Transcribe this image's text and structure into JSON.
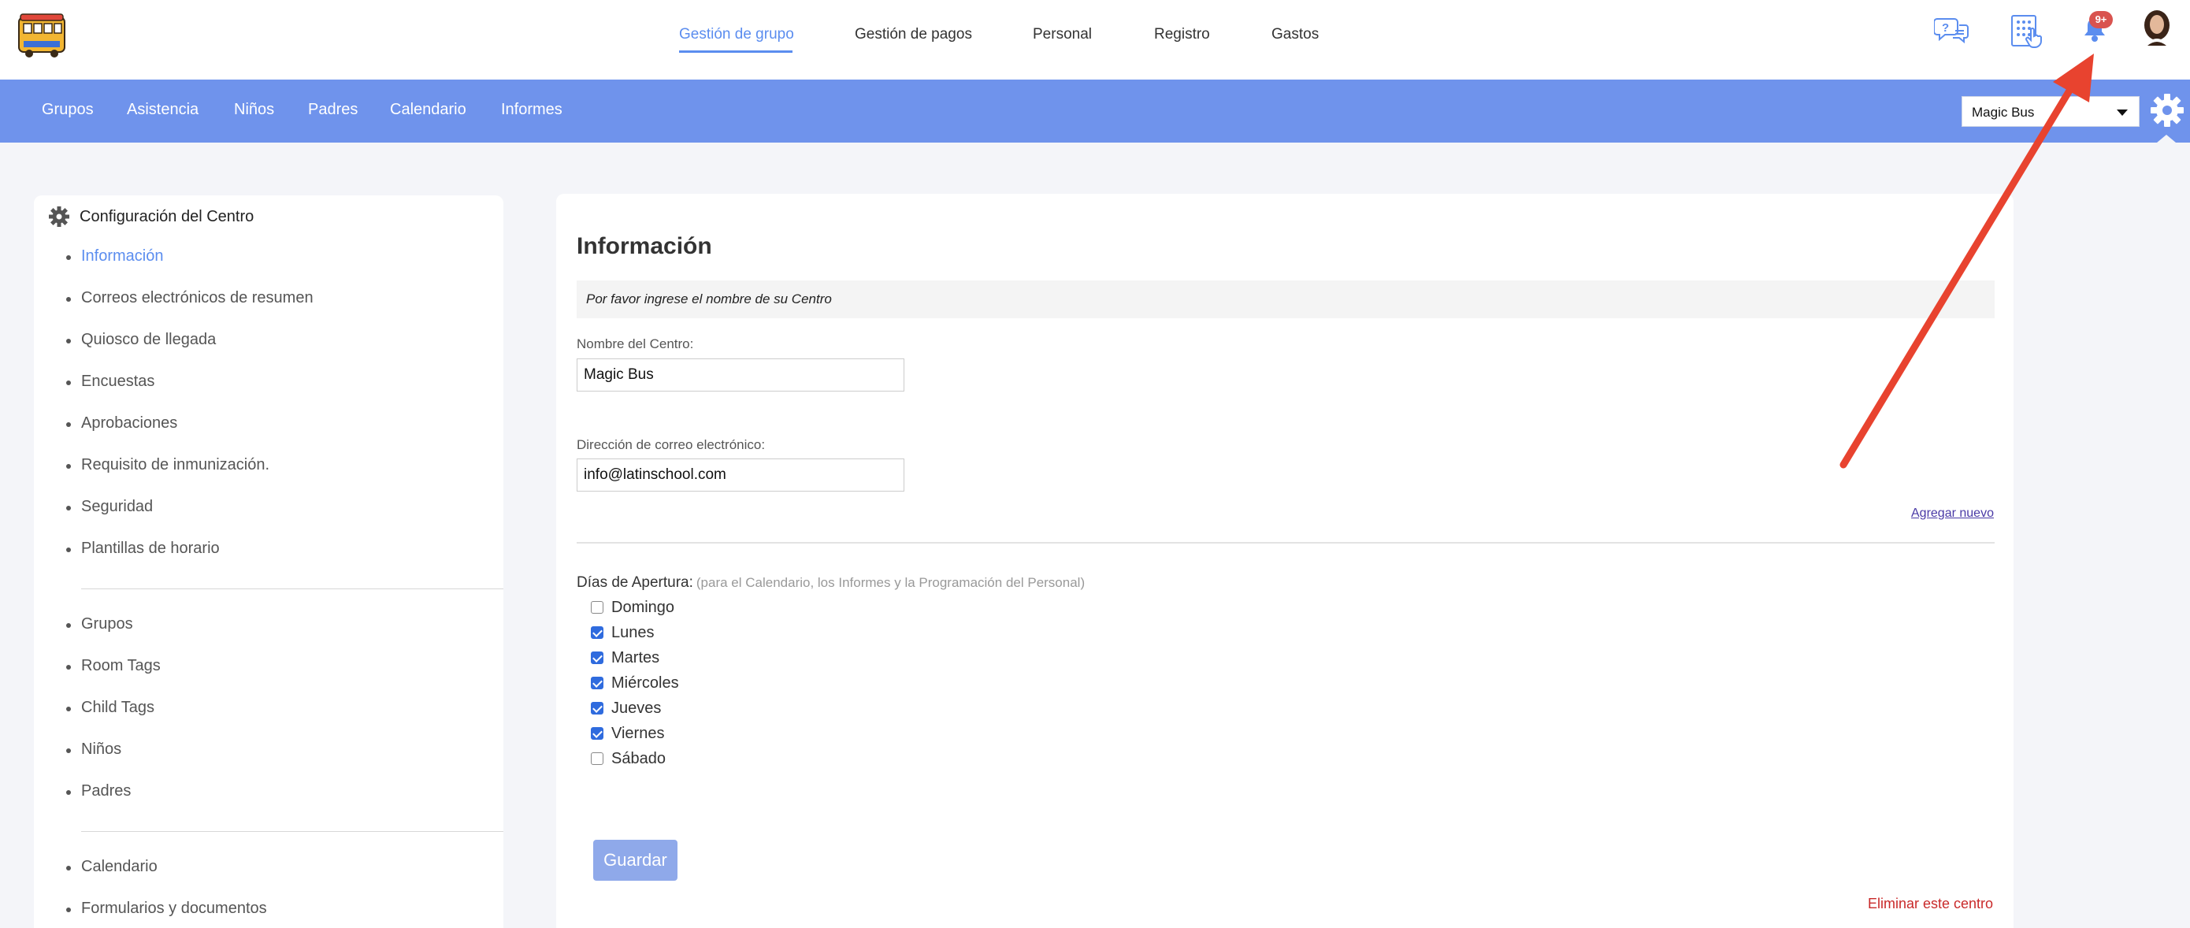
{
  "header": {
    "nav": [
      {
        "label": "Gestión de grupo",
        "active": true
      },
      {
        "label": "Gestión de pagos",
        "active": false
      },
      {
        "label": "Personal",
        "active": false
      },
      {
        "label": "Registro",
        "active": false
      },
      {
        "label": "Gastos",
        "active": false
      }
    ],
    "notifications_badge": "9+",
    "icons": [
      "help-chat-icon",
      "kiosk-keypad-icon",
      "bell-icon",
      "user-avatar"
    ]
  },
  "subnav": {
    "items": [
      "Grupos",
      "Asistencia",
      "Niños",
      "Padres",
      "Calendario",
      "Informes"
    ],
    "center_selected": "Magic Bus"
  },
  "sidebar": {
    "title": "Configuración del Centro",
    "items": [
      "Información",
      "Correos electrónicos de resumen",
      "Quiosco de llegada",
      "Encuestas",
      "Aprobaciones",
      "Requisito de inmunización.",
      "Seguridad",
      "Plantillas de horario",
      "Grupos",
      "Room Tags",
      "Child Tags",
      "Niños",
      "Padres",
      "Calendario",
      "Formularios y documentos"
    ]
  },
  "main": {
    "title": "Información",
    "note": "Por favor ingrese el nombre de su Centro",
    "center_name_label": "Nombre del Centro:",
    "center_name_value": "Magic Bus",
    "email_label": "Dirección de correo electrónico:",
    "email_value": "info@latinschool.com",
    "add_new": "Agregar nuevo",
    "days_label": "Días de Apertura:",
    "days_hint": "(para el Calendario, los Informes y la Programación del Personal)",
    "days": [
      {
        "label": "Domingo",
        "checked": false
      },
      {
        "label": "Lunes",
        "checked": true
      },
      {
        "label": "Martes",
        "checked": true
      },
      {
        "label": "Miércoles",
        "checked": true
      },
      {
        "label": "Jueves",
        "checked": true
      },
      {
        "label": "Viernes",
        "checked": true
      },
      {
        "label": "Sábado",
        "checked": false
      }
    ],
    "save_label": "Guardar",
    "delete_label": "Eliminar este centro"
  },
  "colors": {
    "accent": "#5b8def",
    "subnav_bg": "#6f93ec",
    "badge": "#d9534f",
    "annotation_arrow": "#e8432f",
    "delete": "#c92a2a"
  }
}
